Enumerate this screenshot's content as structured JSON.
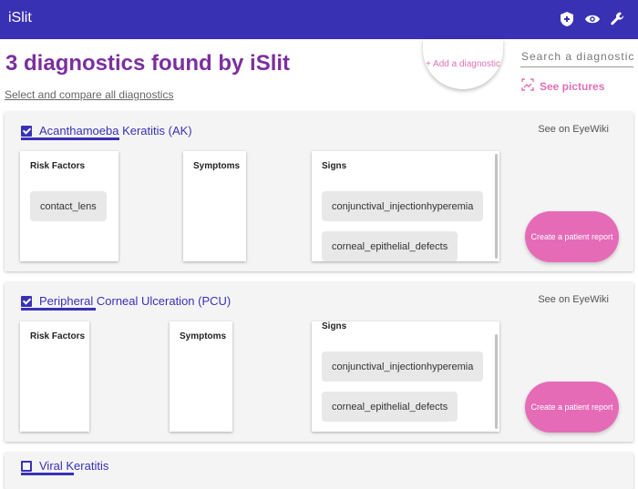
{
  "app": {
    "brand": "iSlit"
  },
  "toolbar": {
    "icons": [
      "shield-plus-icon",
      "eye-icon",
      "wrench-icon"
    ]
  },
  "header": {
    "title": "3 diagnostics found by iSlit",
    "select_all": "Select and compare all diagnostics",
    "add_diagnostic": "+ Add a diagnostic",
    "search_placeholder": "Search a diagnostic",
    "see_pictures": "See pictures"
  },
  "diagnostics": [
    {
      "name": "Acanthamoeba Keratitis (AK)",
      "checked": true,
      "eyewiki": "See on EyeWiki",
      "risk_factors_label": "Risk Factors",
      "symptoms_label": "Symptoms",
      "signs_label": "Signs",
      "risk_factors": [
        "contact_lens"
      ],
      "symptoms": [],
      "signs": [
        "conjunctival_injectionhyperemia",
        "corneal_epithelial_defects"
      ],
      "report_button": "Create a patient report"
    },
    {
      "name": "Peripheral Corneal Ulceration (PCU)",
      "checked": true,
      "eyewiki": "See on EyeWiki",
      "risk_factors_label": "Risk Factors",
      "symptoms_label": "Symptoms",
      "signs_label": "Signs",
      "risk_factors": [],
      "symptoms": [],
      "signs": [
        "conjunctival_injectionhyperemia",
        "corneal_epithelial_defects"
      ],
      "report_button": "Create a patient report"
    },
    {
      "name": "Viral Keratitis",
      "checked": false
    }
  ],
  "colors": {
    "appbar": "#3931b4",
    "heading": "#7b2f9e",
    "accent": "#e070b8",
    "button": "#e56bb7"
  }
}
